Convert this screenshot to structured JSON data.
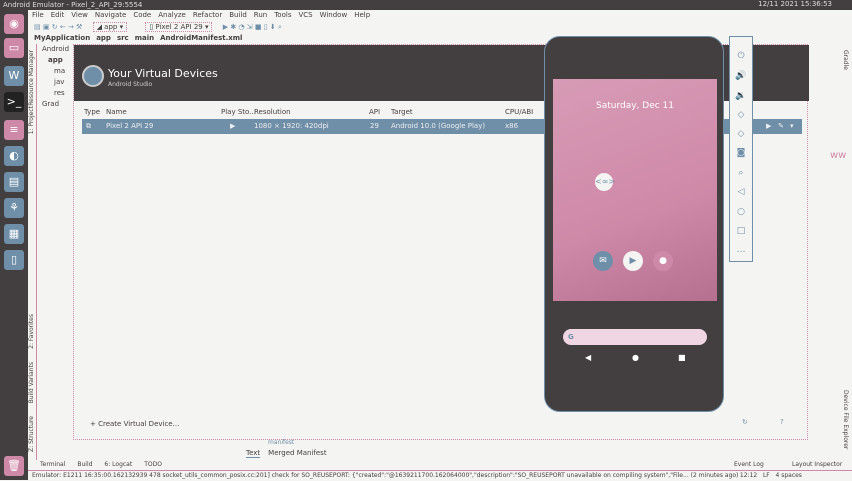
{
  "window": {
    "title": "Android Emulator - Pixel_2_API_29:5554",
    "clock": "12/11 2021  15:36:53"
  },
  "menu": [
    "File",
    "Edit",
    "View",
    "Navigate",
    "Code",
    "Analyze",
    "Refactor",
    "Build",
    "Run",
    "Tools",
    "VCS",
    "Window",
    "Help"
  ],
  "toolbar": {
    "config": "app",
    "device": "Pixel 2 API 29"
  },
  "breadcrumbs": [
    "MyApplication",
    "app",
    "src",
    "main",
    "AndroidManifest.xml"
  ],
  "left_tabs": [
    "Resource Manager",
    "1: Project",
    "2: Favorites",
    "Build Variants",
    "Z: Structure"
  ],
  "tree": [
    "Android",
    "app",
    "ma",
    "jav",
    "res",
    "Grad"
  ],
  "dialog": {
    "title": "Your Virtual Devices",
    "subtitle": "Android Studio",
    "columns": [
      "Type",
      "Name",
      "Play Sto...",
      "Resolution",
      "API",
      "Target",
      "CPU/ABI"
    ],
    "rows": [
      {
        "name": "Pixel 2 API 29",
        "play": "▶",
        "resolution": "1080 × 1920: 420dpi",
        "api": "29",
        "target": "Android 10.0 (Google Play)",
        "cpu": "x86"
      }
    ],
    "create": "+ Create Virtual Device..."
  },
  "phone": {
    "date": "Saturday, Dec 11",
    "search_logo": "G"
  },
  "editor": {
    "file_label": "manifest",
    "tabs": [
      "Text",
      "Merged Manifest"
    ]
  },
  "toolwindows": {
    "left": [
      "Terminal",
      "Build",
      "6: Logcat",
      "TODO"
    ],
    "right": [
      "Event Log",
      "Layout Inspector"
    ],
    "side": [
      "Gradle",
      "Device File Explorer"
    ]
  },
  "status": {
    "message": "Emulator: E1211 16:35:00.162132939   478 socket_utils_common_posix.cc:201] check for SO_REUSEPORT: {\"created\":\"@1639211700.162064000\",\"description\":\"SO_REUSEPORT unavailable on compiling system\",\"File... (2 minutes ago)",
    "position": "12:12",
    "lf": "LF",
    "indent": "4 spaces"
  }
}
